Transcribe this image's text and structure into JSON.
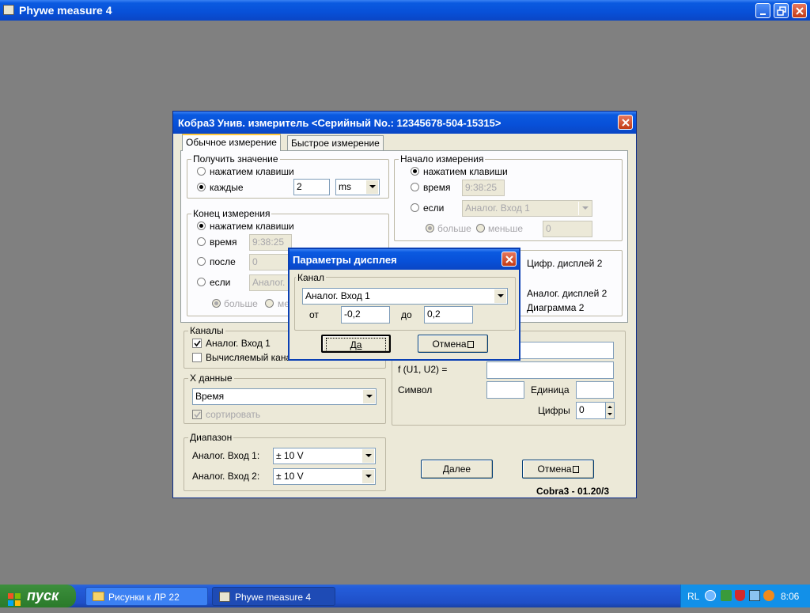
{
  "app_title": "Phywe measure 4",
  "main_dialog": {
    "title": "Кобра3 Унив. измеритель  <Серийный No.: 12345678-504-15315>",
    "tabs": [
      "Обычное измерение",
      "Быстрое измерение"
    ],
    "get_value": {
      "label": "Получить значение",
      "option_key": "нажатием клавиши",
      "option_every": "каждые",
      "every_value": "2",
      "every_unit": "ms"
    },
    "measure_start": {
      "label": "Начало измерения",
      "option_key": "нажатием клавиши",
      "option_time": "время",
      "time_value": "9:38:25",
      "option_if": "если",
      "if_channel": "Аналог. Вход 1",
      "more": "больше",
      "less": "меньше",
      "threshold": "0"
    },
    "measure_end": {
      "label": "Конец измерения",
      "option_key": "нажатием клавиши",
      "option_time": "время",
      "time_value": "9:38:25",
      "option_after": "после",
      "after_value": "0",
      "option_if": "если",
      "if_channel": "Аналог.",
      "more": "больше",
      "less_partial": "ме"
    },
    "displays": {
      "digital": "Цифр. дисплей 2",
      "analog": "Аналог. дисплей 2",
      "diagram": "Диаграмма 2"
    },
    "channels": {
      "label": "Каналы",
      "analog_in_1": "Аналог. Вход 1",
      "computed": "Вычисляемый канал"
    },
    "calc": {
      "formula_label": "f (U1, U2) =",
      "symbol_label": "Символ",
      "unit_label": "Единица",
      "digits_label": "Цифры",
      "digits_value": "0"
    },
    "x_data": {
      "label": "X данные",
      "value": "Время",
      "sort": "сортировать"
    },
    "range": {
      "label": "Диапазон",
      "in1_label": "Аналог. Вход 1:",
      "in1_value": "± 10 V",
      "in2_label": "Аналог. Вход 2:",
      "in2_value": "± 10 V"
    },
    "next_button": "Далее",
    "cancel_button": "Отмена",
    "version": "Cobra3 - 01.20/3"
  },
  "display_dialog": {
    "title": "Параметры дисплея",
    "channel_label": "Канал",
    "channel_value": "Аналог. Вход 1",
    "from_label": "от",
    "from_value": "-0,2",
    "to_label": "до",
    "to_value": "0,2",
    "ok_button": "Да",
    "cancel_button": "Отмена"
  },
  "taskbar": {
    "start": "пуск",
    "tasks": [
      "Рисунки к ЛР 22",
      "Phywe measure 4"
    ],
    "lang": "RL",
    "clock": "8:06"
  }
}
